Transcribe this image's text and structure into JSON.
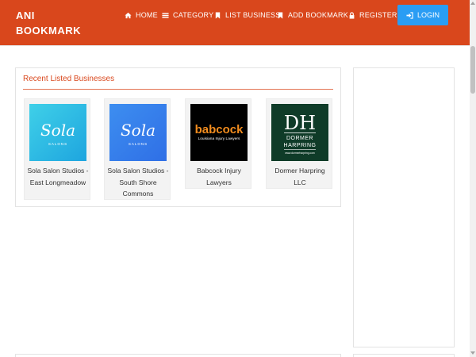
{
  "brand": {
    "line1": "ANI",
    "line2": "BOOKMARK"
  },
  "nav": {
    "home": {
      "label": "HOME",
      "icon": "home-icon"
    },
    "category": {
      "label": "CATEGORY",
      "icon": "list-icon"
    },
    "list_business": {
      "label": "LIST BUSINESS",
      "icon": "bookmark-icon"
    },
    "add_bookmark": {
      "label": "ADD BOOKMARK",
      "icon": "bookmark-icon"
    },
    "register": {
      "label": "REGISTER",
      "icon": "lock-icon"
    },
    "login": {
      "label": "LOGIN",
      "icon": "sign-in-icon"
    }
  },
  "colors": {
    "accent": "#d9471c",
    "login_button": "#2a9df4"
  },
  "recent": {
    "title": "Recent Listed Businesses",
    "items": [
      {
        "name": "Sola Salon Studios - East Longmeadow",
        "logo": {
          "word": "Sola",
          "sub": "SALONS"
        }
      },
      {
        "name": "Sola Salon Studios - South Shore Commons",
        "logo": {
          "word": "Sola",
          "sub": "SALONS"
        }
      },
      {
        "name": "Babcock Injury Lawyers",
        "logo": {
          "word": "babcock",
          "sub": "Louisiana Injury Lawyers"
        }
      },
      {
        "name": "Dormer Harpring LLC",
        "logo": {
          "mark": "DH",
          "line1": "DORMER",
          "line2": "HARPRING",
          "small": "www.dormerharpring.com"
        }
      }
    ]
  }
}
